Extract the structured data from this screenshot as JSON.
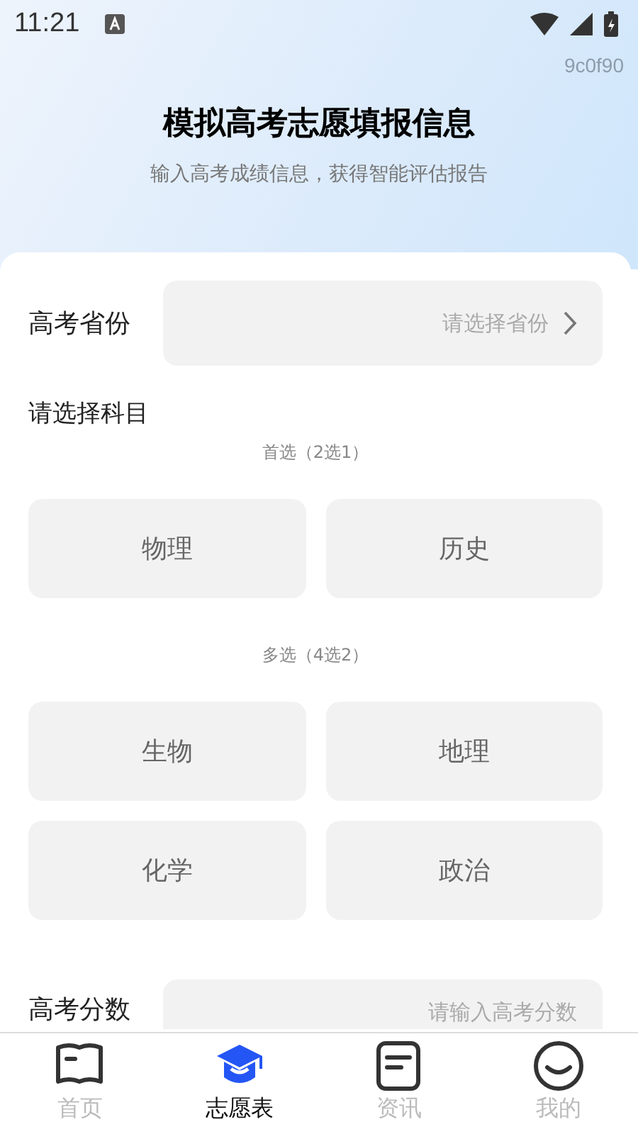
{
  "status_bar": {
    "time": "11:21"
  },
  "header": {
    "code": "9c0f90",
    "title": "模拟高考志愿填报信息",
    "subtitle": "输入高考成绩信息，获得智能评估报告"
  },
  "province": {
    "label": "高考省份",
    "placeholder": "请选择省份"
  },
  "subjects": {
    "label": "请选择科目",
    "groups": [
      {
        "caption": "首选（2选1）",
        "options": [
          {
            "label": "物理",
            "selected": false
          },
          {
            "label": "历史",
            "selected": false
          }
        ]
      },
      {
        "caption": "多选（4选2）",
        "options": [
          {
            "label": "生物",
            "selected": false
          },
          {
            "label": "地理",
            "selected": false
          },
          {
            "label": "化学",
            "selected": false
          },
          {
            "label": "政治",
            "selected": false
          }
        ]
      }
    ]
  },
  "score": {
    "label": "高考分数",
    "placeholder": "请输入高考分数"
  },
  "tabs": [
    {
      "label": "首页",
      "selected": false
    },
    {
      "label": "志愿表",
      "selected": true
    },
    {
      "label": "资讯",
      "selected": false
    },
    {
      "label": "我的",
      "selected": false
    }
  ]
}
